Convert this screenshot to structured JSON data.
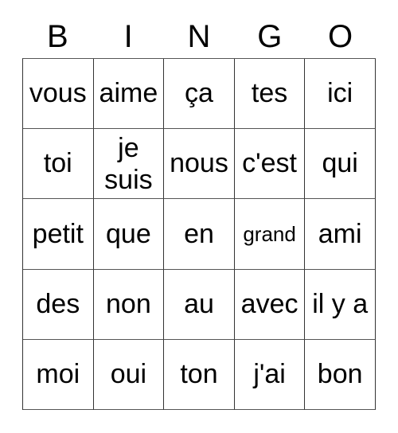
{
  "card": {
    "title": "BINGO",
    "header_letters": [
      "B",
      "I",
      "N",
      "G",
      "O"
    ],
    "border_color": "#333333",
    "text_color": "#000000",
    "background_color": "#ffffff",
    "rows": [
      [
        {
          "text": "vous",
          "size": "normal"
        },
        {
          "text": "aime",
          "size": "normal"
        },
        {
          "text": "ça",
          "size": "normal"
        },
        {
          "text": "tes",
          "size": "normal"
        },
        {
          "text": "ici",
          "size": "normal"
        }
      ],
      [
        {
          "text": "toi",
          "size": "normal"
        },
        {
          "text": "je\nsuis",
          "size": "normal"
        },
        {
          "text": "nous",
          "size": "normal"
        },
        {
          "text": "c'est",
          "size": "normal"
        },
        {
          "text": "qui",
          "size": "normal"
        }
      ],
      [
        {
          "text": "petit",
          "size": "normal"
        },
        {
          "text": "que",
          "size": "normal"
        },
        {
          "text": "en",
          "size": "normal"
        },
        {
          "text": "grand",
          "size": "small"
        },
        {
          "text": "ami",
          "size": "normal"
        }
      ],
      [
        {
          "text": "des",
          "size": "normal"
        },
        {
          "text": "non",
          "size": "normal"
        },
        {
          "text": "au",
          "size": "normal"
        },
        {
          "text": "avec",
          "size": "normal"
        },
        {
          "text": "il y a",
          "size": "normal"
        }
      ],
      [
        {
          "text": "moi",
          "size": "normal"
        },
        {
          "text": "oui",
          "size": "normal"
        },
        {
          "text": "ton",
          "size": "normal"
        },
        {
          "text": "j'ai",
          "size": "normal"
        },
        {
          "text": "bon",
          "size": "normal"
        }
      ]
    ]
  }
}
